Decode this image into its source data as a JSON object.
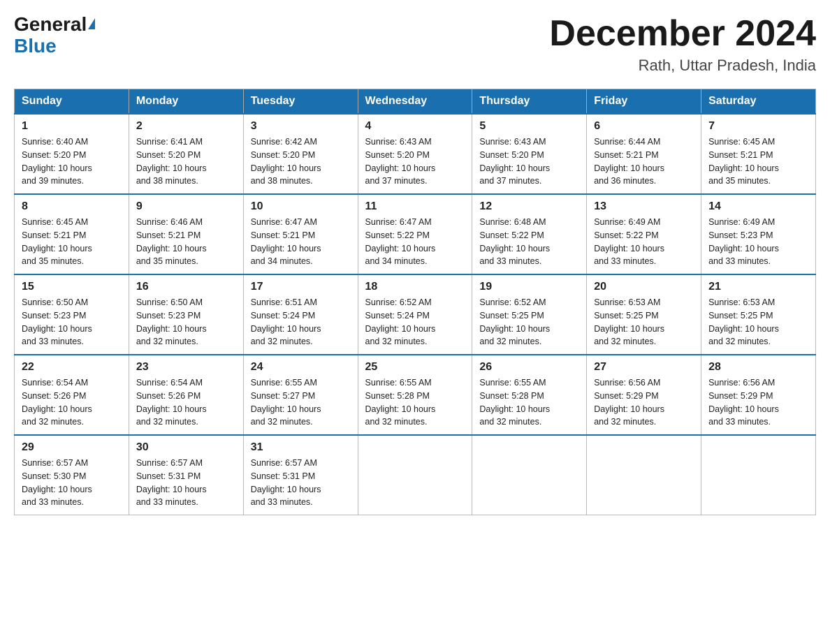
{
  "logo": {
    "general": "General",
    "blue": "Blue"
  },
  "header": {
    "month_year": "December 2024",
    "location": "Rath, Uttar Pradesh, India"
  },
  "days_of_week": [
    "Sunday",
    "Monday",
    "Tuesday",
    "Wednesday",
    "Thursday",
    "Friday",
    "Saturday"
  ],
  "weeks": [
    [
      {
        "day": "1",
        "sunrise": "6:40 AM",
        "sunset": "5:20 PM",
        "daylight": "10 hours and 39 minutes."
      },
      {
        "day": "2",
        "sunrise": "6:41 AM",
        "sunset": "5:20 PM",
        "daylight": "10 hours and 38 minutes."
      },
      {
        "day": "3",
        "sunrise": "6:42 AM",
        "sunset": "5:20 PM",
        "daylight": "10 hours and 38 minutes."
      },
      {
        "day": "4",
        "sunrise": "6:43 AM",
        "sunset": "5:20 PM",
        "daylight": "10 hours and 37 minutes."
      },
      {
        "day": "5",
        "sunrise": "6:43 AM",
        "sunset": "5:20 PM",
        "daylight": "10 hours and 37 minutes."
      },
      {
        "day": "6",
        "sunrise": "6:44 AM",
        "sunset": "5:21 PM",
        "daylight": "10 hours and 36 minutes."
      },
      {
        "day": "7",
        "sunrise": "6:45 AM",
        "sunset": "5:21 PM",
        "daylight": "10 hours and 35 minutes."
      }
    ],
    [
      {
        "day": "8",
        "sunrise": "6:45 AM",
        "sunset": "5:21 PM",
        "daylight": "10 hours and 35 minutes."
      },
      {
        "day": "9",
        "sunrise": "6:46 AM",
        "sunset": "5:21 PM",
        "daylight": "10 hours and 35 minutes."
      },
      {
        "day": "10",
        "sunrise": "6:47 AM",
        "sunset": "5:21 PM",
        "daylight": "10 hours and 34 minutes."
      },
      {
        "day": "11",
        "sunrise": "6:47 AM",
        "sunset": "5:22 PM",
        "daylight": "10 hours and 34 minutes."
      },
      {
        "day": "12",
        "sunrise": "6:48 AM",
        "sunset": "5:22 PM",
        "daylight": "10 hours and 33 minutes."
      },
      {
        "day": "13",
        "sunrise": "6:49 AM",
        "sunset": "5:22 PM",
        "daylight": "10 hours and 33 minutes."
      },
      {
        "day": "14",
        "sunrise": "6:49 AM",
        "sunset": "5:23 PM",
        "daylight": "10 hours and 33 minutes."
      }
    ],
    [
      {
        "day": "15",
        "sunrise": "6:50 AM",
        "sunset": "5:23 PM",
        "daylight": "10 hours and 33 minutes."
      },
      {
        "day": "16",
        "sunrise": "6:50 AM",
        "sunset": "5:23 PM",
        "daylight": "10 hours and 32 minutes."
      },
      {
        "day": "17",
        "sunrise": "6:51 AM",
        "sunset": "5:24 PM",
        "daylight": "10 hours and 32 minutes."
      },
      {
        "day": "18",
        "sunrise": "6:52 AM",
        "sunset": "5:24 PM",
        "daylight": "10 hours and 32 minutes."
      },
      {
        "day": "19",
        "sunrise": "6:52 AM",
        "sunset": "5:25 PM",
        "daylight": "10 hours and 32 minutes."
      },
      {
        "day": "20",
        "sunrise": "6:53 AM",
        "sunset": "5:25 PM",
        "daylight": "10 hours and 32 minutes."
      },
      {
        "day": "21",
        "sunrise": "6:53 AM",
        "sunset": "5:25 PM",
        "daylight": "10 hours and 32 minutes."
      }
    ],
    [
      {
        "day": "22",
        "sunrise": "6:54 AM",
        "sunset": "5:26 PM",
        "daylight": "10 hours and 32 minutes."
      },
      {
        "day": "23",
        "sunrise": "6:54 AM",
        "sunset": "5:26 PM",
        "daylight": "10 hours and 32 minutes."
      },
      {
        "day": "24",
        "sunrise": "6:55 AM",
        "sunset": "5:27 PM",
        "daylight": "10 hours and 32 minutes."
      },
      {
        "day": "25",
        "sunrise": "6:55 AM",
        "sunset": "5:28 PM",
        "daylight": "10 hours and 32 minutes."
      },
      {
        "day": "26",
        "sunrise": "6:55 AM",
        "sunset": "5:28 PM",
        "daylight": "10 hours and 32 minutes."
      },
      {
        "day": "27",
        "sunrise": "6:56 AM",
        "sunset": "5:29 PM",
        "daylight": "10 hours and 32 minutes."
      },
      {
        "day": "28",
        "sunrise": "6:56 AM",
        "sunset": "5:29 PM",
        "daylight": "10 hours and 33 minutes."
      }
    ],
    [
      {
        "day": "29",
        "sunrise": "6:57 AM",
        "sunset": "5:30 PM",
        "daylight": "10 hours and 33 minutes."
      },
      {
        "day": "30",
        "sunrise": "6:57 AM",
        "sunset": "5:31 PM",
        "daylight": "10 hours and 33 minutes."
      },
      {
        "day": "31",
        "sunrise": "6:57 AM",
        "sunset": "5:31 PM",
        "daylight": "10 hours and 33 minutes."
      },
      null,
      null,
      null,
      null
    ]
  ],
  "labels": {
    "sunrise": "Sunrise:",
    "sunset": "Sunset:",
    "daylight": "Daylight:"
  }
}
